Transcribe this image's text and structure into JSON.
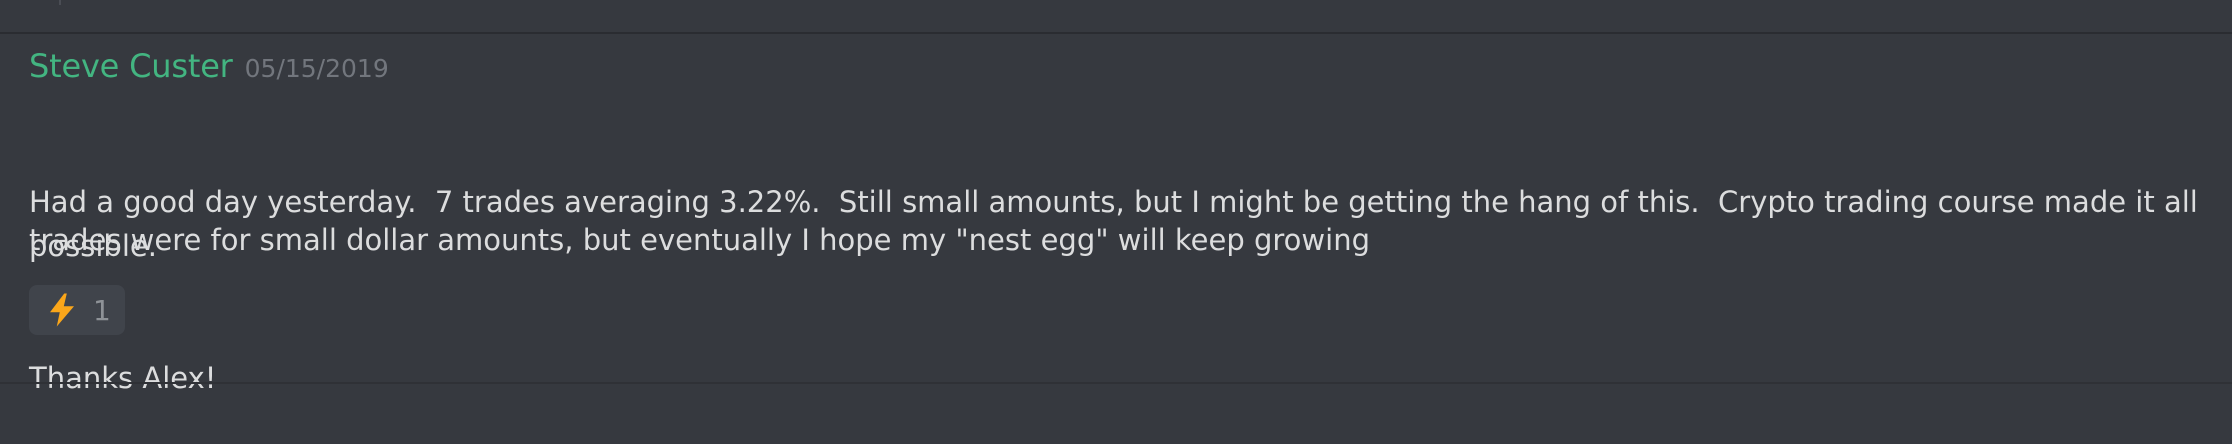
{
  "message": {
    "author": "Steve Custer",
    "timestamp": "05/15/2019",
    "author_color": "#43b581",
    "lines": [
      "Had a good day yesterday.  7 trades averaging 3.22%.  Still small amounts, but I might be getting the hang of this.  Crypto trading course made it all possible.",
      "Thanks Alex!"
    ],
    "followup": "trades were for small dollar amounts, but eventually I hope my \"nest egg\" will keep growing",
    "reaction": {
      "emoji": "zap-icon",
      "count": "1"
    }
  },
  "colors": {
    "background": "#36393f",
    "text": "#dcddde",
    "muted": "#72767d",
    "reaction_bg": "#40444b",
    "emoji": "#faa61a"
  }
}
